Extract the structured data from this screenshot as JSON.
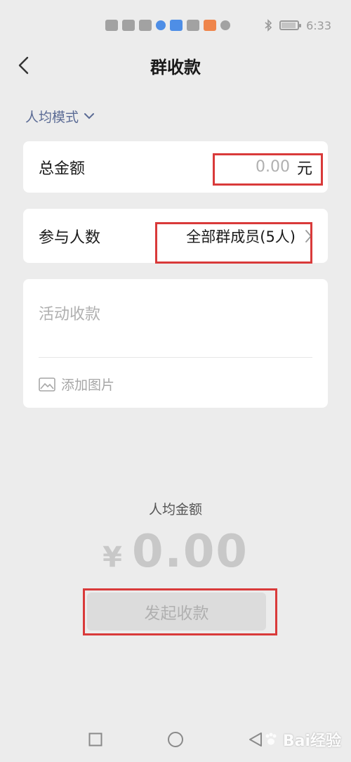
{
  "status_bar": {
    "time": "6:33",
    "icons": [
      "hd-icon",
      "4g-signal-icon",
      "wifi-icon",
      "app-notification-icon",
      "browser-icon",
      "text-icon",
      "app-icon",
      "android-icon",
      "bluetooth-icon",
      "battery-icon"
    ]
  },
  "header": {
    "title": "群收款"
  },
  "mode": {
    "label": "人均模式"
  },
  "total_amount": {
    "label": "总金额",
    "placeholder": "0.00",
    "unit": "元"
  },
  "participants": {
    "label": "参与人数",
    "value": "全部群成员(5人)"
  },
  "note": {
    "placeholder": "活动收款",
    "add_image_label": "添加图片"
  },
  "per_person": {
    "label": "人均金额",
    "currency": "¥",
    "amount": "0.00"
  },
  "submit": {
    "label": "发起收款"
  },
  "watermark": {
    "text": "Bai经验"
  },
  "colors": {
    "background": "#ececec",
    "card": "#ffffff",
    "accent_mode": "#5b6b95",
    "highlight": "#d93a3a",
    "disabled": "#b0b0b0"
  }
}
